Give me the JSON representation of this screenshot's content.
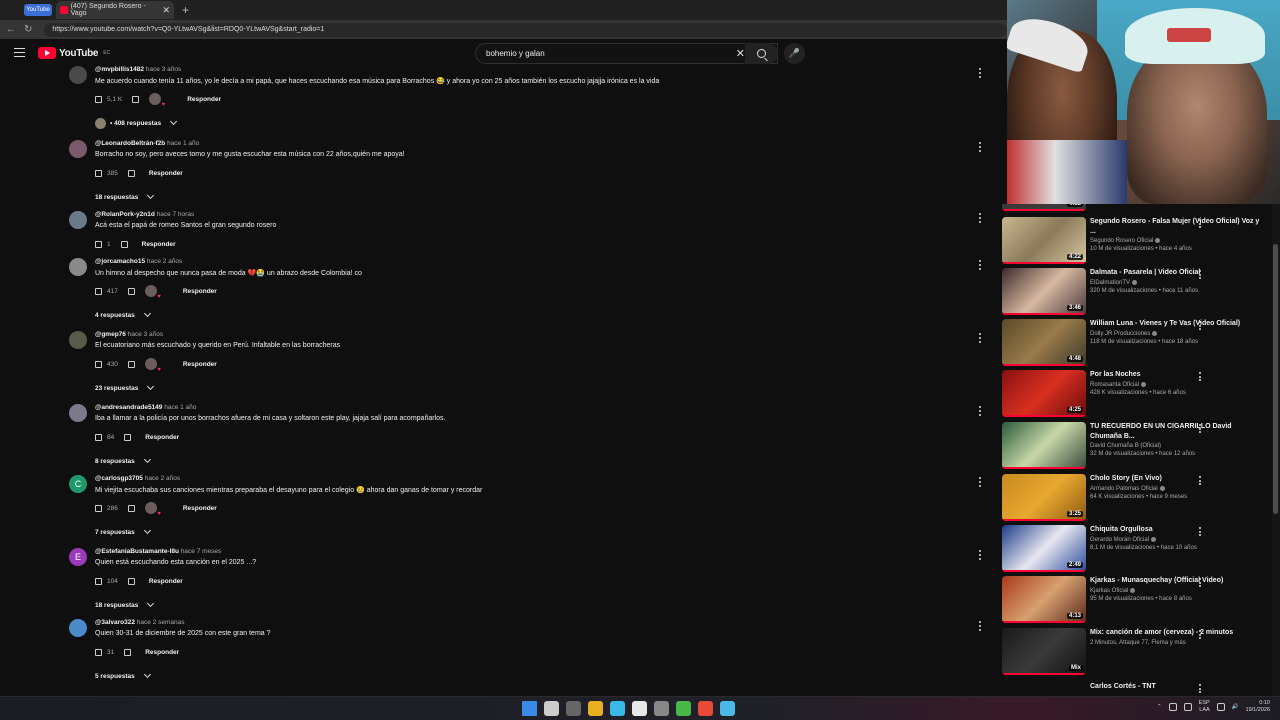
{
  "browser": {
    "mini_tab_label": "YouTube",
    "active_tab_title": "(407) Segundo Rosero - Vago",
    "url": "https://www.youtube.com/watch?v=Q0-YLtwAVSg&list=RDQ0-YLtwAVSg&start_radio=1"
  },
  "header": {
    "logo_text": "YouTube",
    "country": "EC",
    "search_value": "bohemio y galan"
  },
  "comments": [
    {
      "user": "@mvpbillis1482",
      "time": "hace 3 años",
      "text": "Me acuerdo cuando tenía 11 años, yo le decía a mi papá, que haces escuchando esa música para Borrachos 😂 y ahora yo con 25 años también los escucho jajajja irónica es la vida",
      "likes": "5,1 K",
      "reply": "Responder",
      "replies": "• 408 respuestas",
      "avatar_color": "#4a4a4a",
      "heart": true,
      "reply_avatar": true
    },
    {
      "user": "@LeonardoBeltrán-f2b",
      "time": "hace 1 año",
      "text": "Borracho no soy, pero aveces tomo y me gusta escuchar esta música con 22 años,quién me apoya!",
      "likes": "385",
      "reply": "Responder",
      "replies": "18 respuestas",
      "avatar_color": "#7a5a6a",
      "heart": false
    },
    {
      "user": "@RolanPork-y2n1d",
      "time": "hace 7 horas",
      "text": "Acá esta el papá de romeo Santos  el gran segundo rosero",
      "likes": "1",
      "reply": "Responder",
      "replies": "",
      "avatar_color": "#6a7a8a",
      "heart": false
    },
    {
      "user": "@jorcamacho15",
      "time": "hace 2 años",
      "text": "Un himno al despecho que nunca pasa de moda 💔😭 un abrazo desde Colombia! co",
      "likes": "417",
      "reply": "Responder",
      "replies": "4 respuestas",
      "avatar_color": "#8a8a8a",
      "heart": true
    },
    {
      "user": "@gmep76",
      "time": "hace 3 años",
      "text": "El ecuatoriano más escuchado y querido en Perú.  Infaltable en las borracheras",
      "likes": "430",
      "reply": "Responder",
      "replies": "23 respuestas",
      "avatar_color": "#5a5a4a",
      "heart": true
    },
    {
      "user": "@andresandrade5149",
      "time": "hace 1 año",
      "text": "Iba a llamar a la policía por unos borrachos afuera de mi casa y soltaron este play, jajaja salí para acompañarlos.",
      "likes": "84",
      "reply": "Responder",
      "replies": "8 respuestas",
      "avatar_color": "#7a7a8a",
      "heart": false
    },
    {
      "user": "@carlosgp3705",
      "time": "hace 2 años",
      "text": "Mi viejita escuchaba sus canciones mientras preparaba el desayuno para el colegio 😢 ahora dan ganas de tomar y recordar",
      "likes": "286",
      "reply": "Responder",
      "replies": "7 respuestas",
      "avatar_color": "#1e9a6a",
      "avatar_letter": "C",
      "heart": true
    },
    {
      "user": "@EstefaniaBustamante-l8u",
      "time": "hace 7 meses",
      "text": "Quien está escuchando  esta canción en el 2025 ...?",
      "likes": "104",
      "reply": "Responder",
      "replies": "18 respuestas",
      "avatar_color": "#9a3ab8",
      "avatar_letter": "E",
      "heart": false
    },
    {
      "user": "@3alvaro322",
      "time": "hace 2 semanas",
      "text": "Quien 30-31 de diciembre de 2025 con este gran tema ?",
      "likes": "31",
      "reply": "Responder",
      "replies": "5 respuestas",
      "avatar_color": "#4a8ac8",
      "heart": false
    }
  ],
  "recommendations": [
    {
      "title": "Segundo Rosero - Falsa Mujer (Video Oficial) Voz y ...",
      "channel": "Segundo Rosero Oficial",
      "stats": "10 M de visualizaciones • hace 4 años",
      "duration": "4:22",
      "verified": true,
      "thumb": "linear-gradient(135deg,#c8b890,#8a7a5a 50%,#d8c8a0)"
    },
    {
      "title": "Dalmata - Pasarela | Video Oficial",
      "channel": "ElDalmationTV",
      "stats": "320 M de visualizaciones • hace 11 años",
      "duration": "3:46",
      "verified": true,
      "thumb": "linear-gradient(135deg,#3a2a2a,#d8b8a0 50%,#4a3a3a)"
    },
    {
      "title": "William Luna - Vienes y Te Vas (Video Oficial)",
      "channel": "Dolly JR Producciones",
      "stats": "118 M de visualizaciones • hace 18 años",
      "duration": "4:48",
      "verified": true,
      "thumb": "linear-gradient(135deg,#5a4a2a,#9a7a4a 50%,#3a3a2a)"
    },
    {
      "title": "Por las Noches",
      "channel": "Romasanta Oficial",
      "stats": "428 K visualizaciones • hace 6 años",
      "duration": "4:25",
      "verified": true,
      "thumb": "linear-gradient(135deg,#8a1010,#d83020 50%,#6a0a0a)"
    },
    {
      "title": "TU RECUERDO EN UN CIGARRILLO David Chumaña B...",
      "channel": "David Chumaña B (Oficial)",
      "stats": "32 M de visualizaciones • hace 12 años",
      "duration": "",
      "verified": false,
      "thumb": "linear-gradient(135deg,#2a5a3a,#c8d8a8 50%,#3a4a3a)"
    },
    {
      "title": "Cholo Story (En Vivo)",
      "channel": "Armando Palomas Oficial",
      "stats": "64 K visualizaciones • hace 9 meses",
      "duration": "3:25",
      "verified": true,
      "thumb": "linear-gradient(135deg,#c88a20,#e8a830 50%,#8a5a10)"
    },
    {
      "title": "Chiquita Orgullosa",
      "channel": "Gerardo Morán Oficial",
      "stats": "8,1 M de visualizaciones • hace 10 años",
      "duration": "2:49",
      "verified": true,
      "thumb": "linear-gradient(135deg,#1a3a8a,#e8e8f0 50%,#2a4a9a)"
    },
    {
      "title": "Kjarkas - Munasquechay (Official Video)",
      "channel": "Kjarkas Oficial",
      "stats": "95 M de visualizaciones • hace 8 años",
      "duration": "4:13",
      "verified": true,
      "thumb": "linear-gradient(135deg,#a83a1a,#d8a070 50%,#5a2a1a)"
    },
    {
      "title": "Mix: canción de amor (cerveza) - 2 minutos",
      "channel": "2 Minutos, Attaque 77, Flema y más",
      "stats": "",
      "duration": "Mix",
      "verified": false,
      "thumb": "linear-gradient(135deg,#1a1a1a,#3a3a3a 50%,#111)"
    },
    {
      "title": "Carlos Cortés - TNT",
      "channel": "",
      "stats": "",
      "duration": "",
      "verified": false,
      "thumb": "#222"
    }
  ],
  "partial_rec_duration": "4:32",
  "taskbar": {
    "lang": "ESP",
    "lang2": "LAA",
    "time": "0:10",
    "date": "19/1/2026",
    "icon_colors": [
      "#3a8ae8",
      "#cccccc",
      "#666666",
      "#e8b020",
      "#3ab8e8",
      "#e8e8e8",
      "#888888",
      "#4ab848",
      "#e84a3a",
      "#4ab8e8"
    ]
  }
}
